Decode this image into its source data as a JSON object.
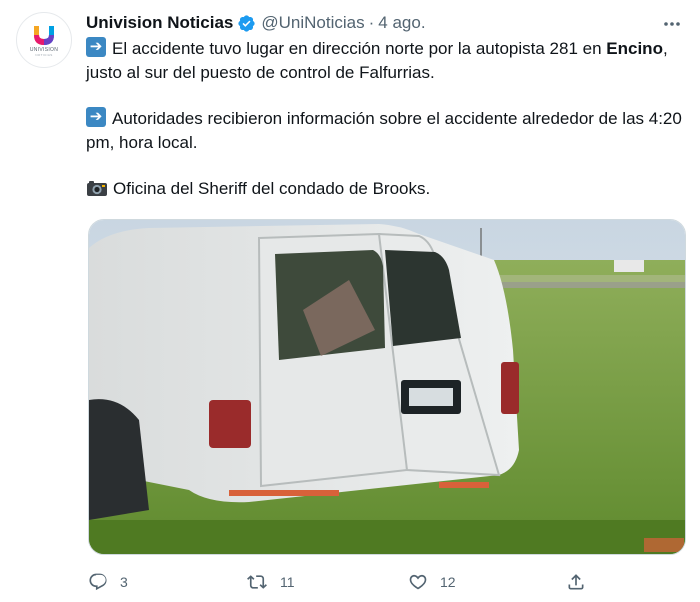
{
  "account": {
    "display_name": "Univision Noticias",
    "handle": "@UniNoticias",
    "separator": "·",
    "date": "4 ago.",
    "avatar_brand": "UNIVISION",
    "avatar_sub": "NOTICIAS",
    "brand_colors": [
      "#f5a623",
      "#e4007c",
      "#00a0e3",
      "#7b2fbe"
    ]
  },
  "tweet": {
    "p1_a": "El accidente tuvo lugar en dirección norte por la autopista 281 en",
    "p1_bold": "Encino",
    "p1_b": ", justo al sur del puesto de control de Falfurrias.",
    "p2": "Autoridades recibieron información sobre el accidente alrededor de las 4:20 pm, hora local.",
    "p3": "Oficina del Sheriff del condado de Brooks."
  },
  "icons": {
    "verified": "verified-badge-icon",
    "more": "more-options-icon",
    "arrow_emoji": "right-arrow-emoji-icon",
    "camera_emoji": "camera-emoji-icon"
  },
  "photo": {
    "alt": "Camioneta blanca accidentada en un campo de hierba"
  },
  "actions": {
    "reply_count": "3",
    "retweet_count": "11",
    "like_count": "12"
  },
  "colors": {
    "verified_blue": "#1d9bf0",
    "text_primary": "#0f1419",
    "text_secondary": "#536471"
  }
}
